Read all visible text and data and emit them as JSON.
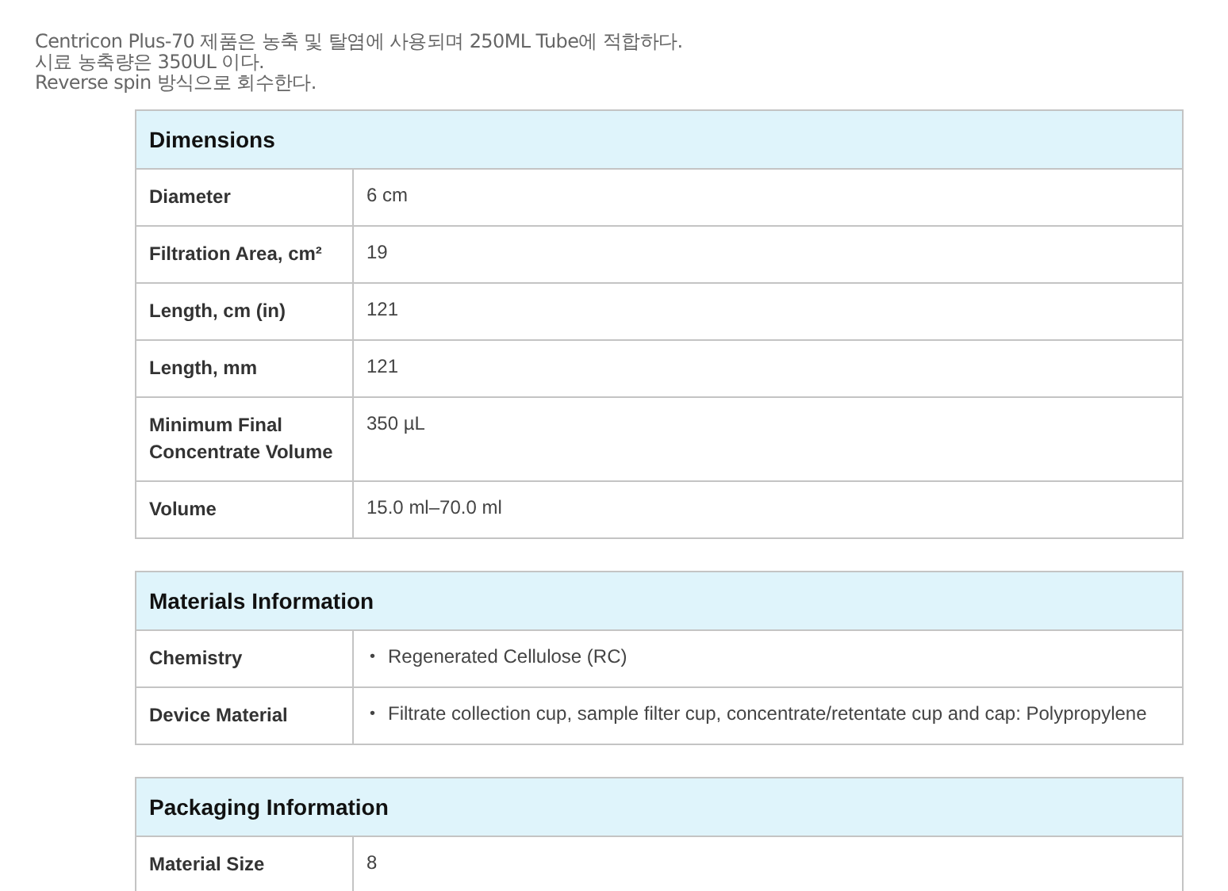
{
  "intro": [
    "Centricon Plus-70 제품은 농축 및 탈염에 사용되며 250ML Tube에 적합하다.",
    "시료 농축량은 350UL 이다.",
    "Reverse spin 방식으로 회수한다."
  ],
  "sections": [
    {
      "title": "Dimensions",
      "rows": [
        {
          "label": "Diameter",
          "kind": "text",
          "value": "6 cm"
        },
        {
          "label": "Filtration Area, cm²",
          "kind": "text",
          "value": "19"
        },
        {
          "label": "Length, cm (in)",
          "kind": "text",
          "value": "121"
        },
        {
          "label": "Length, mm",
          "kind": "text",
          "value": "121"
        },
        {
          "label": "Minimum Final Concentrate Volume",
          "kind": "text",
          "value": "350 µL"
        },
        {
          "label": "Volume",
          "kind": "text",
          "value": "15.0 ml–70.0 ml"
        }
      ]
    },
    {
      "title": "Materials Information",
      "rows": [
        {
          "label": "Chemistry",
          "kind": "list",
          "items": [
            {
              "bullet": "•",
              "text": "Regenerated Cellulose (RC)"
            }
          ]
        },
        {
          "label": "Device Material",
          "kind": "list",
          "items": [
            {
              "bullet": "•",
              "text": "Filtrate collection cup, sample filter cup, concentrate/retentate cup and cap: Polypropylene"
            }
          ]
        }
      ]
    },
    {
      "title": "Packaging Information",
      "rows": [
        {
          "label": "Material Size",
          "kind": "text",
          "value": "8"
        }
      ]
    }
  ]
}
